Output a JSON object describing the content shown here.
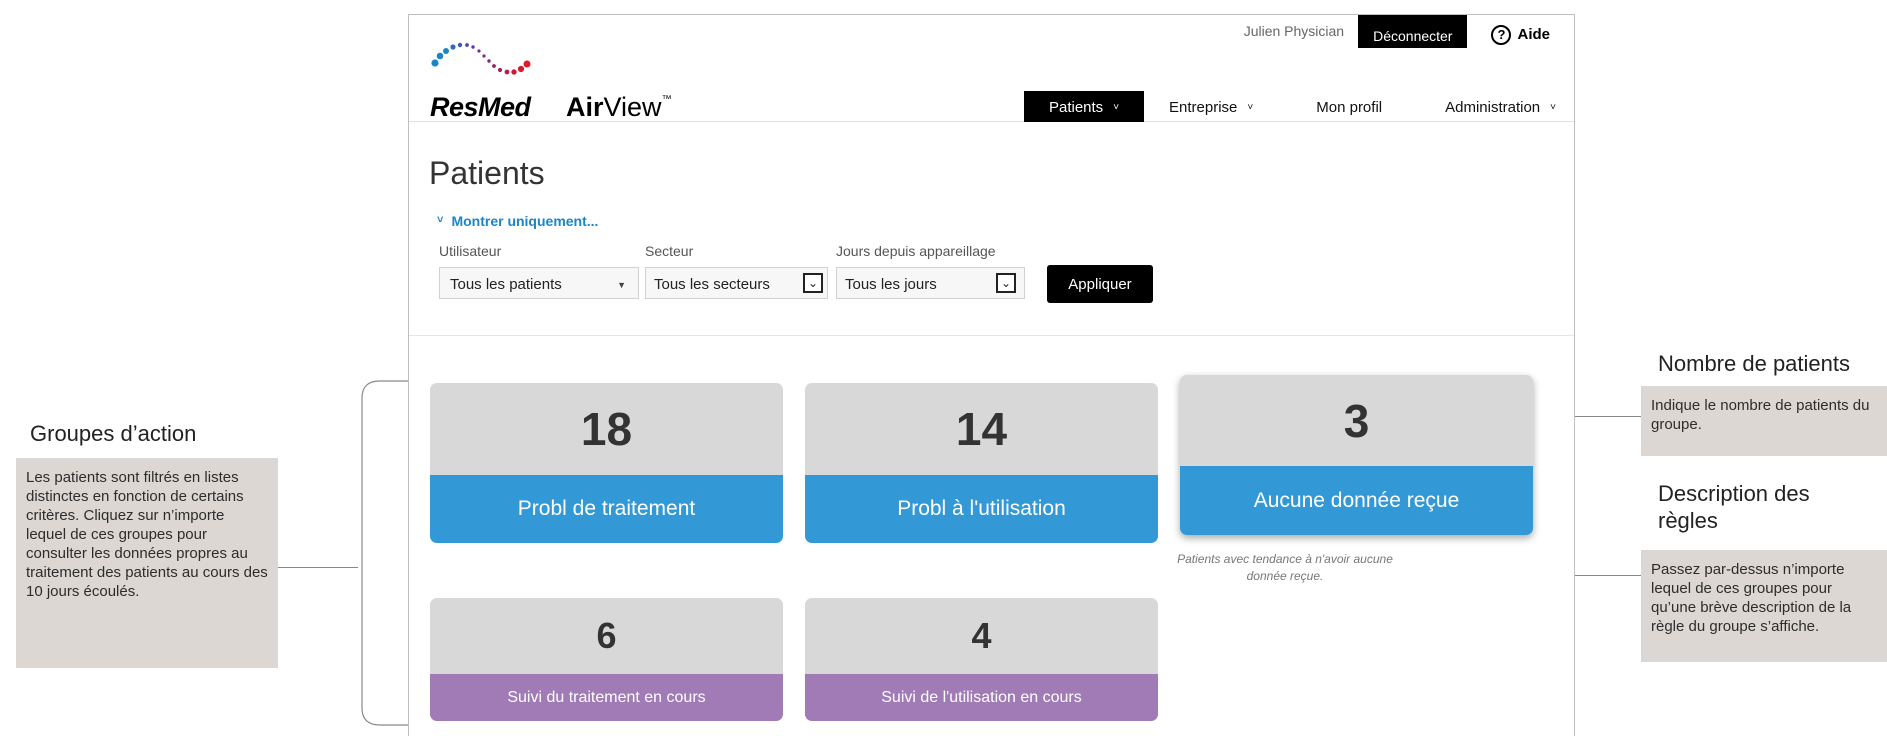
{
  "header": {
    "brand": {
      "resmed": "ResMed",
      "air": "Air",
      "view": "View",
      "tm": "™"
    },
    "user_name": "Julien Physician",
    "logout_label": "Déconnecter",
    "help_icon": "?",
    "help_label": "Aide"
  },
  "nav": {
    "items": [
      {
        "label": "Patients",
        "caret": "˅"
      },
      {
        "label": "Entreprise",
        "caret": "˅"
      },
      {
        "label": "Mon profil",
        "caret": ""
      },
      {
        "label": "Administration",
        "caret": "˅"
      }
    ]
  },
  "page": {
    "title": "Patients",
    "filter_toggle": "Montrer uniquement...",
    "filter_toggle_chevron": "˅"
  },
  "filters": {
    "user": {
      "label": "Utilisateur",
      "value": "Tous les patients",
      "arrow": "▼"
    },
    "sector": {
      "label": "Secteur",
      "value": "Tous les secteurs",
      "arrow": "⌄"
    },
    "days": {
      "label": "Jours depuis appareillage",
      "value": "Tous les jours",
      "arrow": "⌄"
    },
    "apply_label": "Appliquer"
  },
  "groups": [
    {
      "count": "18",
      "label": "Probl de traitement"
    },
    {
      "count": "14",
      "label": "Probl à l'utilisation"
    },
    {
      "count": "3",
      "label": "Aucune donnée reçue",
      "rule": "Patients avec tendance à n'avoir aucune donnée reçue."
    },
    {
      "count": "6",
      "label": "Suivi du traitement en cours"
    },
    {
      "count": "4",
      "label": "Suivi de l'utilisation en cours"
    }
  ],
  "annotations": {
    "groups": {
      "title": "Groupes d’action",
      "text": "Les patients sont filtrés en listes distinctes en fonction de certains critères. Cliquez sur n’importe lequel de ces groupes pour consulter les données propres au traitement des patients au cours des 10 jours écoulés."
    },
    "count": {
      "title": "Nombre de patients",
      "text": "Indique le nombre de patients du groupe."
    },
    "rules": {
      "title": "Description des règles",
      "text": "Passez par-dessus n’importe lequel de ces groupes pour qu’une brève description de la règle du groupe s’affiche."
    }
  },
  "colors": {
    "accent_blue": "#3399d6",
    "accent_purple": "#a07bb6",
    "link_blue": "#1a85c8",
    "card_grey": "#d8d8d8",
    "annotation_box": "#dcd7d2"
  }
}
